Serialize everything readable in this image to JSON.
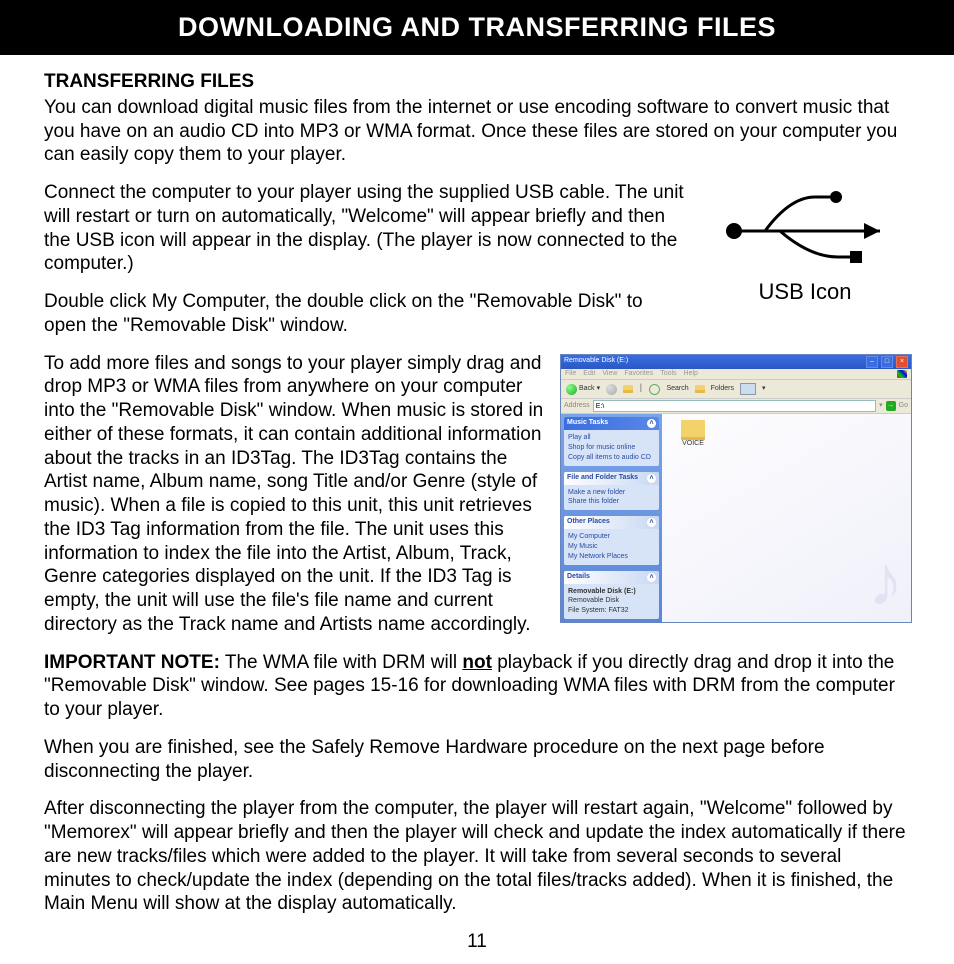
{
  "header": "DOWNLOADING AND TRANSFERRING FILES",
  "section_title": "TRANSFERRING FILES",
  "p1": "You can download digital music files from the internet or use encoding software to convert music that you have on an audio CD into MP3 or WMA format. Once these files are stored on your computer you can easily copy them to your player.",
  "p2": "Connect the computer to your player using the supplied USB cable. The unit will restart or turn on automatically, \"Welcome\" will appear briefly and then the USB icon will appear in the display. (The player is now connected to the computer.)",
  "p3": "Double click My Computer, the double click on the \"Removable Disk\" to open the \"Removable Disk\" window.",
  "p4": "To add more files and songs to your player simply drag and drop MP3 or WMA files from anywhere on your computer into the \"Removable Disk\" window. When music is stored in either of these formats, it can contain additional information about the tracks in an ID3Tag. The ID3Tag contains the Artist name, Album name, song Title and/or Genre (style of music). When a file is copied to this unit, this unit retrieves the ID3 Tag information from the file. The unit uses this information to index the file into the Artist, Album, Track, Genre categories displayed on the unit. If the ID3 Tag is empty, the unit will use the file's file name and current directory as the Track name and Artists name accordingly.",
  "note_label": "IMPORTANT NOTE:",
  "note_text_1": " The WMA file with DRM will ",
  "note_not": "not",
  "note_text_2": " playback if you directly drag and drop it into the \"Removable Disk\" window. See pages 15-16 for downloading WMA files with DRM from the computer to your player.",
  "p6": "When you are finished, see the Safely Remove Hardware procedure on the next page before disconnecting the player.",
  "p7": "After disconnecting the player from the computer, the player will restart again, \"Welcome\" followed by \"Memorex\" will appear briefly and then the player will check and update the index automatically if there are new tracks/files which were added to the player. It will take from several seconds to several minutes to check/update the index (depending on the total files/tracks added). When it is finished, the Main Menu will show at the display automatically.",
  "usb_caption": "USB Icon",
  "page_number": "11",
  "xp": {
    "title": "Removable Disk (E:)",
    "menu": [
      "File",
      "Edit",
      "View",
      "Favorites",
      "Tools",
      "Help"
    ],
    "toolbar": {
      "back": "Back",
      "search": "Search",
      "folders": "Folders"
    },
    "addr_label": "Address",
    "addr_value": "E:\\",
    "go": "Go",
    "panel_music": "Music Tasks",
    "music_items": [
      "Play all",
      "Shop for music online",
      "Copy all items to audio CD"
    ],
    "panel_ff": "File and Folder Tasks",
    "ff_items": [
      "Make a new folder",
      "Share this folder"
    ],
    "panel_other": "Other Places",
    "other_items": [
      "My Computer",
      "My Music",
      "My Network Places"
    ],
    "panel_details": "Details",
    "details_title": "Removable Disk (E:)",
    "details_line1": "Removable Disk",
    "details_line2": "File System: FAT32",
    "folder": "VOICE"
  }
}
